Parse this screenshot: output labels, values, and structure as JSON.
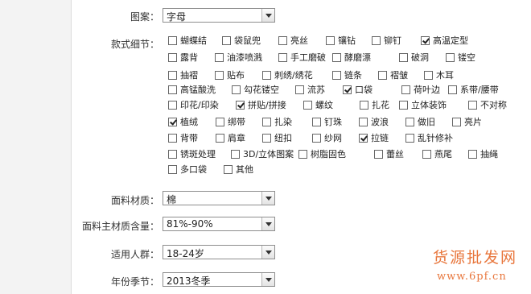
{
  "fields": {
    "pattern": {
      "label": "图案：",
      "value": "字母"
    },
    "details_label": "款式细节：",
    "fabric": {
      "label": "面料材质：",
      "value": "棉"
    },
    "fabric_content": {
      "label": "面料主材质含量：",
      "value": "81%-90%"
    },
    "audience": {
      "label": "适用人群：",
      "value": "18-24岁"
    },
    "season": {
      "label": "年份季节：",
      "value": "2013冬季"
    }
  },
  "details": [
    {
      "label": "蝴蝶结",
      "checked": false
    },
    {
      "label": "袋鼠兜",
      "checked": false
    },
    {
      "label": "亮丝",
      "checked": false
    },
    {
      "label": "镶钻",
      "checked": false
    },
    {
      "label": "铆钉",
      "checked": false
    },
    {
      "label": "高温定型",
      "checked": true
    },
    {
      "label": "露背",
      "checked": false
    },
    {
      "label": "油漆喷溅",
      "checked": false
    },
    {
      "label": "手工磨破",
      "checked": false
    },
    {
      "label": "酵磨漂",
      "checked": false
    },
    {
      "label": "破洞",
      "checked": false
    },
    {
      "label": "镂空",
      "checked": false
    },
    {
      "label": "抽褶",
      "checked": false
    },
    {
      "label": "贴布",
      "checked": false
    },
    {
      "label": "刺绣/绣花",
      "checked": false
    },
    {
      "label": "链条",
      "checked": false
    },
    {
      "label": "褶皱",
      "checked": false
    },
    {
      "label": "木耳",
      "checked": false
    },
    {
      "label": "高锰酸洗",
      "checked": false
    },
    {
      "label": "勾花镂空",
      "checked": false
    },
    {
      "label": "流苏",
      "checked": false
    },
    {
      "label": "口袋",
      "checked": true
    },
    {
      "label": "荷叶边",
      "checked": false
    },
    {
      "label": "系带/腰带",
      "checked": false
    },
    {
      "label": "印花/印染",
      "checked": false
    },
    {
      "label": "拼贴/拼接",
      "checked": true
    },
    {
      "label": "螺纹",
      "checked": false
    },
    {
      "label": "扎花",
      "checked": false
    },
    {
      "label": "立体装饰",
      "checked": false
    },
    {
      "label": "不对称",
      "checked": false
    },
    {
      "label": "植绒",
      "checked": true
    },
    {
      "label": "绑带",
      "checked": false
    },
    {
      "label": "扎染",
      "checked": false
    },
    {
      "label": "钉珠",
      "checked": false
    },
    {
      "label": "波浪",
      "checked": false
    },
    {
      "label": "做旧",
      "checked": false
    },
    {
      "label": "亮片",
      "checked": false
    },
    {
      "label": "背带",
      "checked": false
    },
    {
      "label": "肩章",
      "checked": false
    },
    {
      "label": "纽扣",
      "checked": false
    },
    {
      "label": "纱网",
      "checked": false
    },
    {
      "label": "拉链",
      "checked": true
    },
    {
      "label": "乱针修补",
      "checked": false
    },
    {
      "label": "锈斑处理",
      "checked": false
    },
    {
      "label": "3D/立体图案",
      "checked": false
    },
    {
      "label": "树脂固色",
      "checked": false
    },
    {
      "label": "蕾丝",
      "checked": false
    },
    {
      "label": "燕尾",
      "checked": false
    },
    {
      "label": "抽绳",
      "checked": false
    },
    {
      "label": "多口袋",
      "checked": false
    },
    {
      "label": "其他",
      "checked": false
    }
  ],
  "watermark": {
    "line1": "货源批发网",
    "line2": "www.6pf.cn"
  },
  "colors": {
    "panel_bg": "#ffffff",
    "page_bg": "#f3f3f3",
    "watermark": "#e8763c"
  }
}
